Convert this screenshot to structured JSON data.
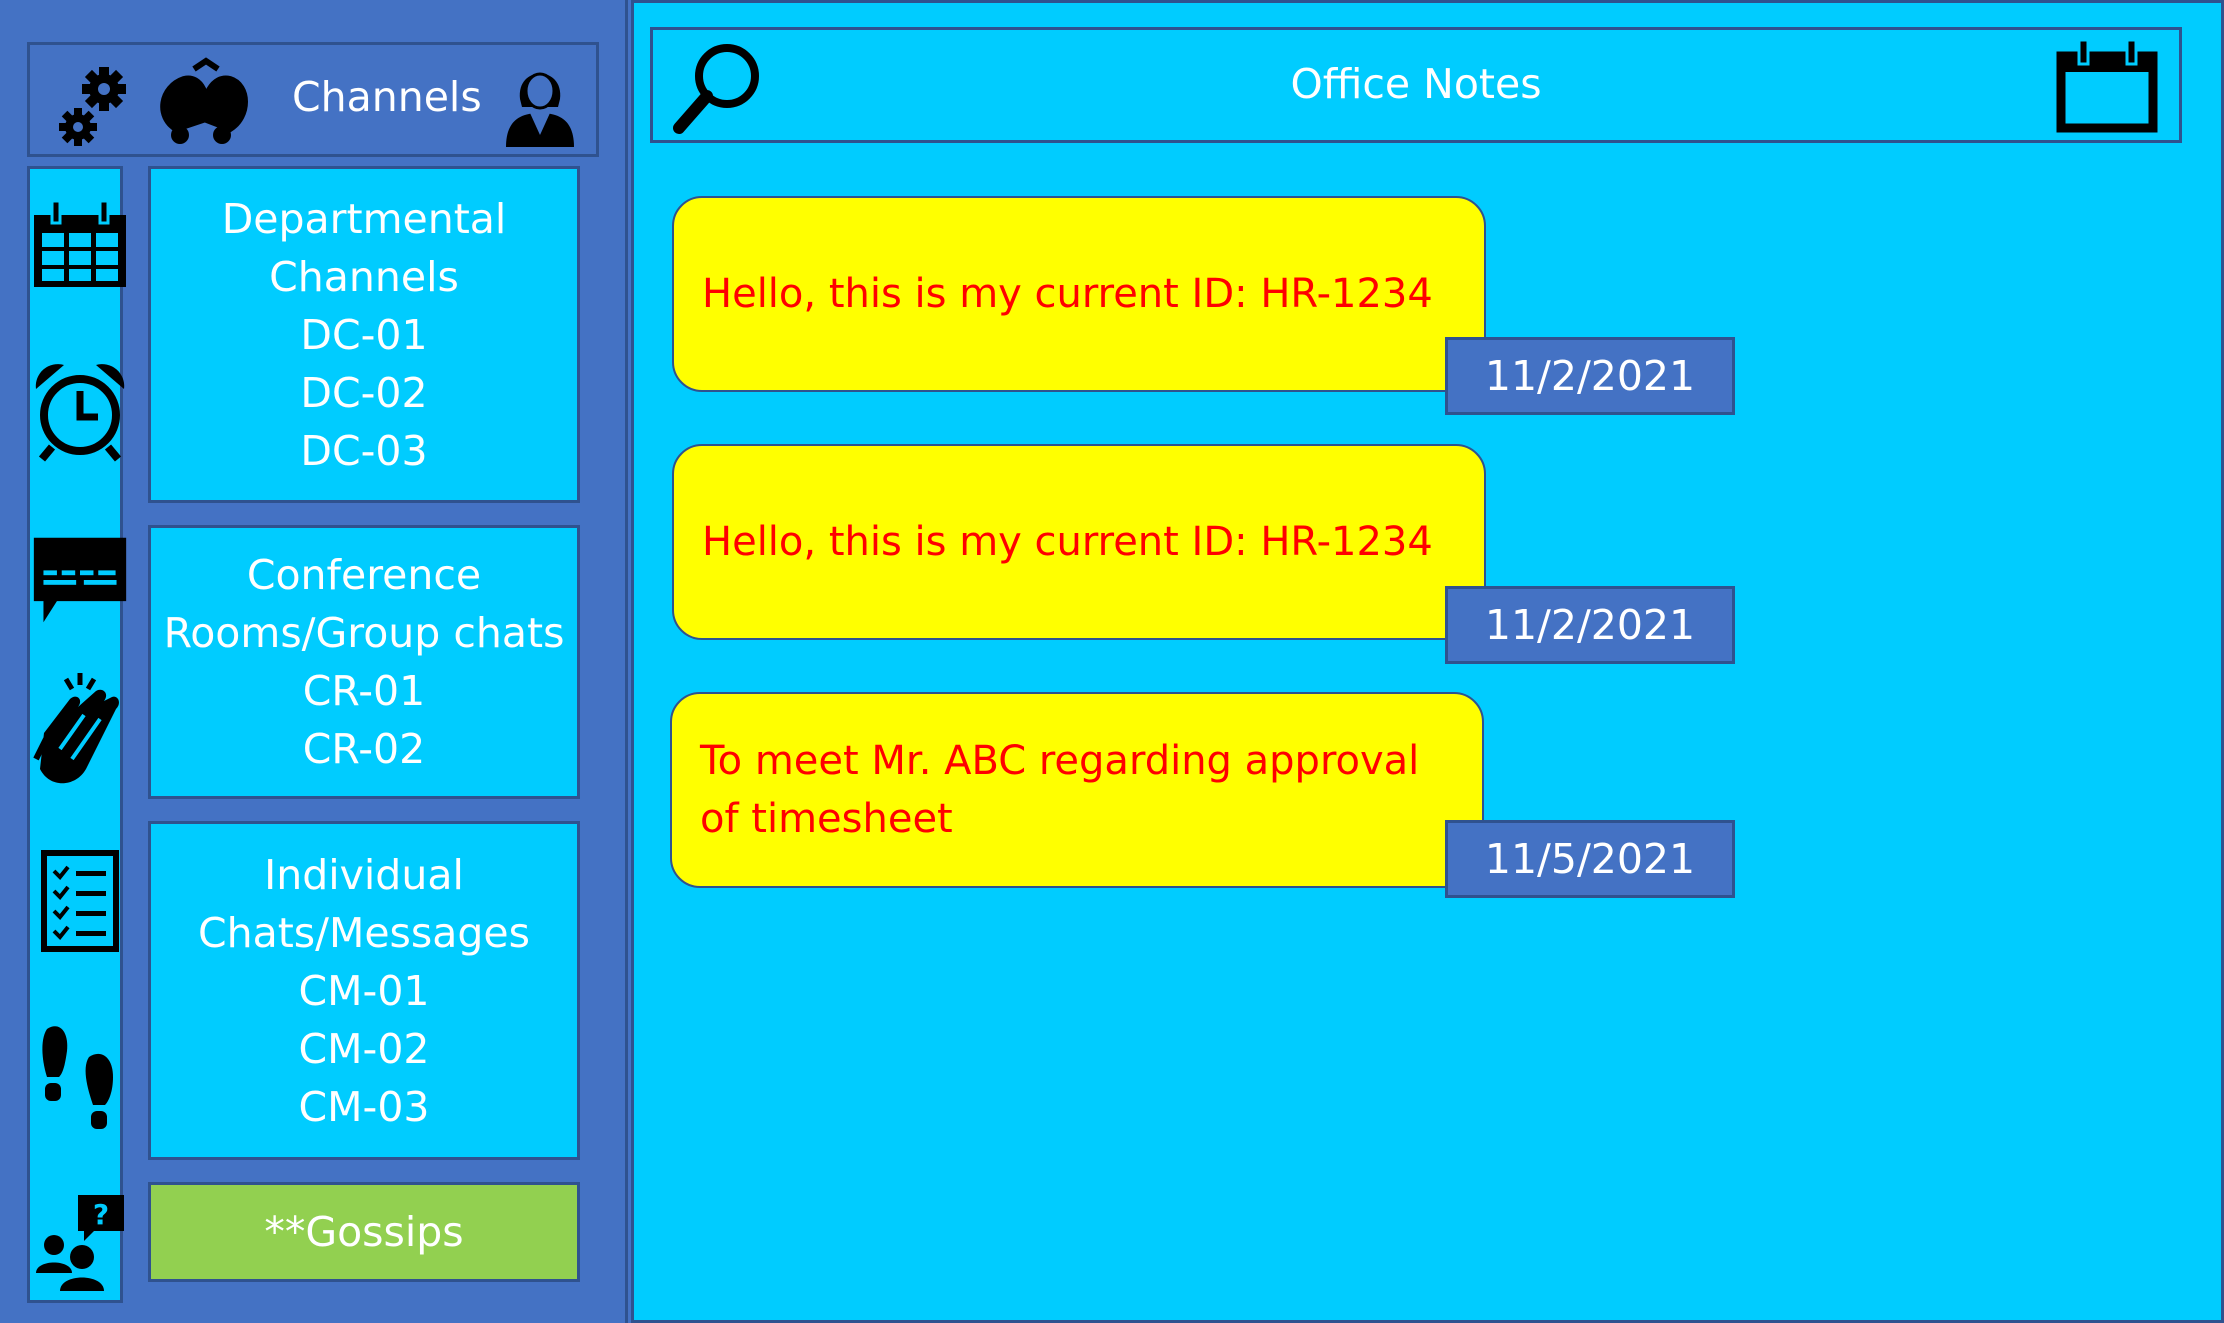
{
  "sidebar": {
    "header": {
      "title": "Channels"
    },
    "groups": [
      {
        "lines": [
          "Departmental",
          "Channels",
          "DC-01",
          "DC-02",
          "DC-03"
        ]
      },
      {
        "lines": [
          "Conference",
          "Rooms/Group chats",
          "CR-01",
          "CR-02"
        ]
      },
      {
        "lines": [
          "Individual",
          "Chats/Messages",
          "CM-01",
          "CM-02",
          "CM-03"
        ]
      }
    ],
    "gossips_label": "**Gossips",
    "rail_icons": [
      "calendar-icon",
      "alarm-clock-icon",
      "chat-icon",
      "clapping-hands-icon",
      "checklist-icon",
      "footprints-icon",
      "help-people-icon"
    ]
  },
  "header": {
    "title": "Office Notes",
    "left_icon": "search-icon",
    "right_icon": "calendar-icon"
  },
  "messages": [
    {
      "text": "Hello, this is my current ID: HR-1234",
      "date": "11/2/2021"
    },
    {
      "text": "Hello, this is my current ID: HR-1234",
      "date": "11/2/2021"
    },
    {
      "text": "To meet Mr. ABC regarding approval of timesheet",
      "date": "11/5/2021"
    }
  ],
  "colors": {
    "sidebar_bg": "#4472c4",
    "panel_bg": "#00ccff",
    "border": "#2f528f",
    "bubble_bg": "#ffff00",
    "bubble_text": "#ff0000",
    "gossips_bg": "#92d050"
  }
}
